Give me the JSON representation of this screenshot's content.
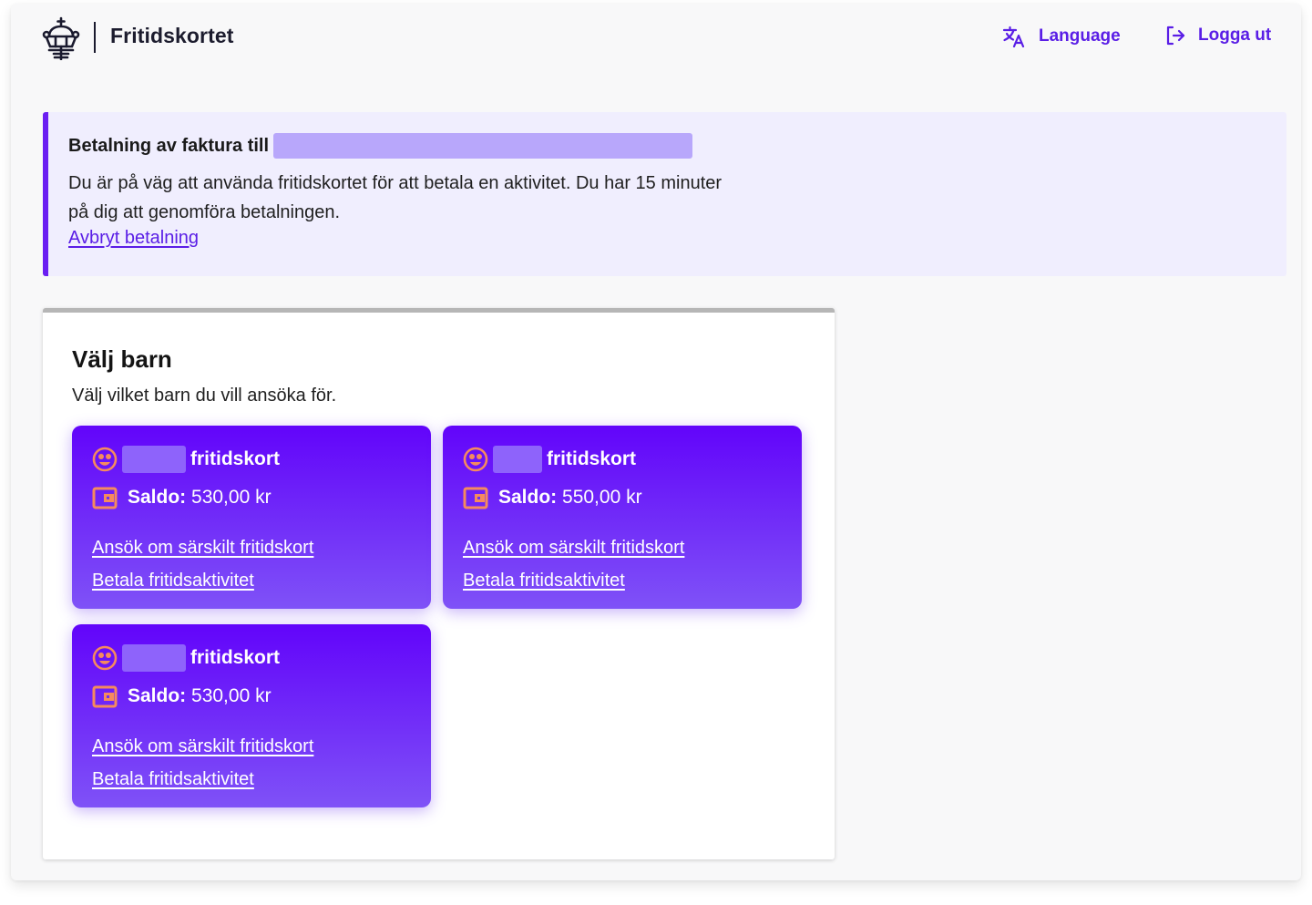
{
  "header": {
    "brand": "Fritidskortet",
    "language_label": "Language",
    "logout_label": "Logga ut"
  },
  "notice": {
    "title": "Betalning av faktura till",
    "text": "Du är på väg att använda fritidskortet för att betala en aktivitet. Du har 15 minuter på dig att genomföra betalningen.",
    "cancel_link": "Avbryt betalning"
  },
  "panel": {
    "title": "Välj barn",
    "subtitle": "Välj vilket barn du vill ansöka för."
  },
  "cards": [
    {
      "name_suffix": "fritidskort",
      "saldo_label": "Saldo:",
      "saldo_value": "530,00 kr",
      "apply_link": "Ansök om särskilt fritidskort",
      "pay_link": "Betala fritidsaktivitet"
    },
    {
      "name_suffix": "fritidskort",
      "saldo_label": "Saldo:",
      "saldo_value": "550,00 kr",
      "apply_link": "Ansök om särskilt fritidskort",
      "pay_link": "Betala fritidsaktivitet"
    },
    {
      "name_suffix": "fritidskort",
      "saldo_label": "Saldo:",
      "saldo_value": "530,00 kr",
      "apply_link": "Ansök om särskilt fritidskort",
      "pay_link": "Betala fritidsaktivitet"
    }
  ],
  "colors": {
    "accent": "#5a1ee6",
    "card_top": "#6204fa",
    "card_bottom": "#7f52f7",
    "notice_bg": "#f0eefe",
    "icon_orange": "#f58a5e"
  },
  "icons": {
    "logo": "crown-logo-icon",
    "language": "translate-icon",
    "logout": "logout-icon",
    "child": "face-icon",
    "wallet": "wallet-icon"
  }
}
